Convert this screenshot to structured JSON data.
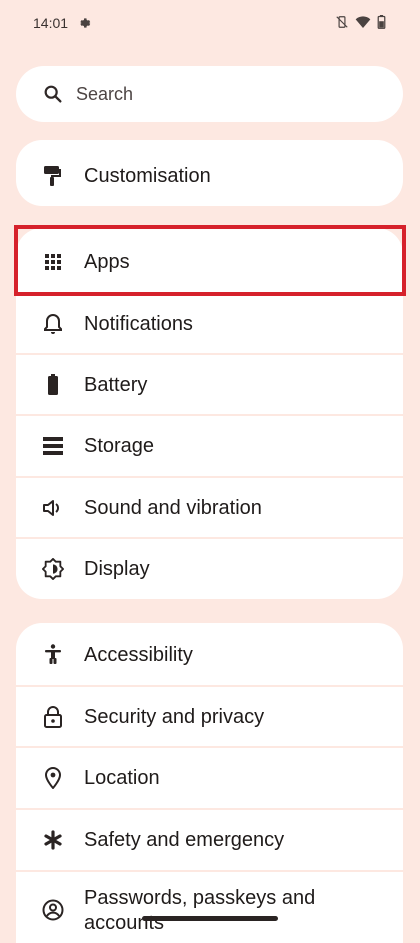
{
  "status_bar": {
    "time": "14:01"
  },
  "search": {
    "placeholder": "Search"
  },
  "groups": {
    "customisation": {
      "label": "Customisation"
    },
    "apps": {
      "label": "Apps"
    },
    "notifications": {
      "label": "Notifications"
    },
    "battery": {
      "label": "Battery"
    },
    "storage": {
      "label": "Storage"
    },
    "sound": {
      "label": "Sound and vibration"
    },
    "display": {
      "label": "Display"
    },
    "accessibility": {
      "label": "Accessibility"
    },
    "security": {
      "label": "Security and privacy"
    },
    "location": {
      "label": "Location"
    },
    "safety": {
      "label": "Safety and emergency"
    },
    "passwords": {
      "label_line1": "Passwords, passkeys and",
      "label_line2": "accounts"
    }
  },
  "colors": {
    "background": "#fde8e1",
    "card": "#ffffff",
    "highlight": "#d6212b"
  }
}
